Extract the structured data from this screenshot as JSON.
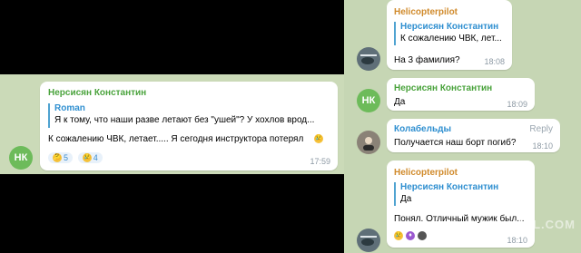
{
  "left": {
    "avatar_initials": "НК",
    "avatar_color": "#6dbb5a",
    "sender": "Нерсисян Константин",
    "sender_color": "#4aa33c",
    "quote_name": "Roman",
    "quote_text": "Я к тому, что наши разве летают без \"ушей\"? У хохлов врод...",
    "body_text": "К сожалению ЧВК, летает..... Я сегодня инструктора потерял",
    "reactions": [
      {
        "icon": "thinking-emoji",
        "count": "5"
      },
      {
        "icon": "crying-emoji",
        "count": "4"
      }
    ],
    "time": "17:59"
  },
  "right": {
    "msg1": {
      "sender": "Helicopterpilot",
      "sender_color": "#d08a2b",
      "quote_name": "Нерсисян Константин",
      "quote_text": "К сожалению ЧВК, лет...",
      "body_text": "На 3 фамилия?",
      "time": "18:08"
    },
    "msg2": {
      "avatar_initials": "НК",
      "avatar_color": "#6dbb5a",
      "sender": "Нерсисян Константин",
      "sender_color": "#4aa33c",
      "body_text": "Да",
      "time": "18:09"
    },
    "msg3": {
      "sender": "Колабельды",
      "sender_color": "#2f8fd0",
      "reply_label": "Reply",
      "body_text": "Получается наш борт погиб?",
      "time": "18:10"
    },
    "msg4": {
      "sender": "Helicopterpilot",
      "sender_color": "#d08a2b",
      "quote_name": "Нерсисян Константин",
      "quote_text": "Да",
      "body_text": "Понял. Отличный мужик был...",
      "time": "18:10"
    },
    "watermark": "YAPLAKAL.COM"
  }
}
